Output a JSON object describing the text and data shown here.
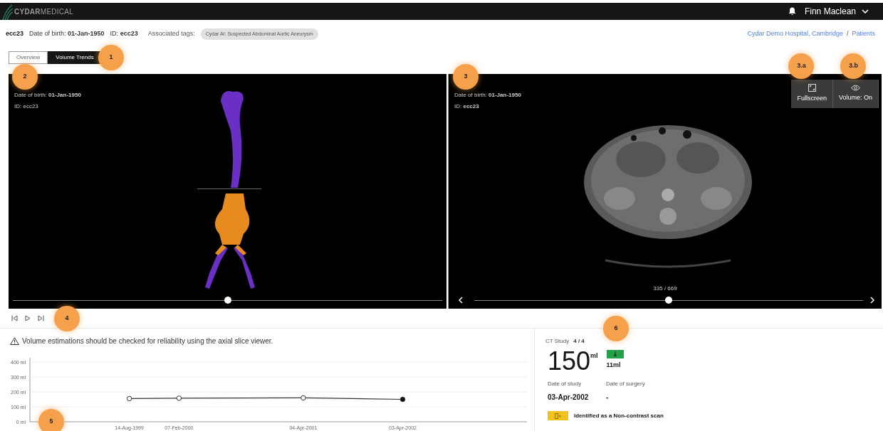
{
  "top_bar": {
    "logo": "**CYDAR**MEDICAL",
    "user": "Finn Maclean"
  },
  "patient": {
    "name": "ecc23",
    "date_of_birth": "Date of birth: **01-Jan-1950**",
    "id": "ID: **ecc23**",
    "tags_label": "Associated tags:",
    "tags": [
      "Cydar AI: Suspected Abdominal Aortic Aneurysm"
    ]
  },
  "breadcrumb": {
    "items": [
      "Cydar Demo Hospital, Cambridge",
      "Patients"
    ],
    "separator": "/"
  },
  "tabs_marker": "1",
  "tabs": [
    {
      "label": "Overview",
      "selected": false
    },
    {
      "label": "Volume Trends",
      "selected": true
    }
  ],
  "model_viewer": {
    "marker": "2",
    "date_of_birth": "Date of birth: **01-Jan-1950**",
    "id": "ID: ecc23",
    "slider": {
      "level": 0.5
    }
  },
  "slice_viewer": {
    "marker": "3",
    "date_of_birth": "Date of birth: **01-Jan-1950**",
    "id": "ID: **ecc23**",
    "buttons": [
      {
        "kind": "fullscreen",
        "label": "Fullscreen",
        "marker": "3.a"
      },
      {
        "kind": "volume",
        "label": "Volume: On",
        "marker": "3.b"
      }
    ],
    "slice": "335 / 669",
    "slider": {
      "level": 0.5
    }
  },
  "playback": {
    "marker": "4"
  },
  "warning": "Volume estimations should be checked for reliability using the axial slice viewer.",
  "trend": {
    "marker": "5",
    "points": [
      {
        "selected": false
      },
      {
        "selected": false
      },
      {
        "selected": false
      },
      {
        "selected": true
      }
    ],
    "chart_data": {
      "type": "line",
      "categories": [
        null,
        null,
        null,
        null,
        "14-Aug-1999",
        null,
        "07-Feb-2000",
        null,
        null,
        null,
        null,
        "04-Apr-2001",
        null,
        null,
        null,
        "03-Apr-2002",
        null,
        null,
        null,
        null
      ],
      "grid": true,
      "series": [
        {
          "color": "#333333",
          "marker": "circle",
          "values": [
            null,
            null,
            null,
            null,
            155,
            null,
            158,
            null,
            null,
            null,
            null,
            160,
            null,
            null,
            null,
            150,
            null,
            null,
            null,
            null
          ]
        }
      ],
      "ylim": [
        0,
        400
      ],
      "yticks": [
        {
          "value": 0,
          "label": "0 ml"
        },
        {
          "value": 100,
          "label": "100 ml"
        },
        {
          "value": 200,
          "label": "200 ml"
        },
        {
          "value": 300,
          "label": "300 ml"
        },
        {
          "value": 400,
          "label": "400 ml"
        }
      ]
    }
  },
  "study": {
    "marker": "6",
    "label": "CT Study",
    "count": "4 / 4",
    "volume": "150",
    "unit": "ml",
    "decreased": true,
    "change": "11ml",
    "date_of_study_label": "Date of study",
    "date_of_study": "03-Apr-2002",
    "date_of_surgery_label": "Date of surgery",
    "date_of_surgery": "-",
    "note": "Identified as a Non-contrast scan"
  }
}
